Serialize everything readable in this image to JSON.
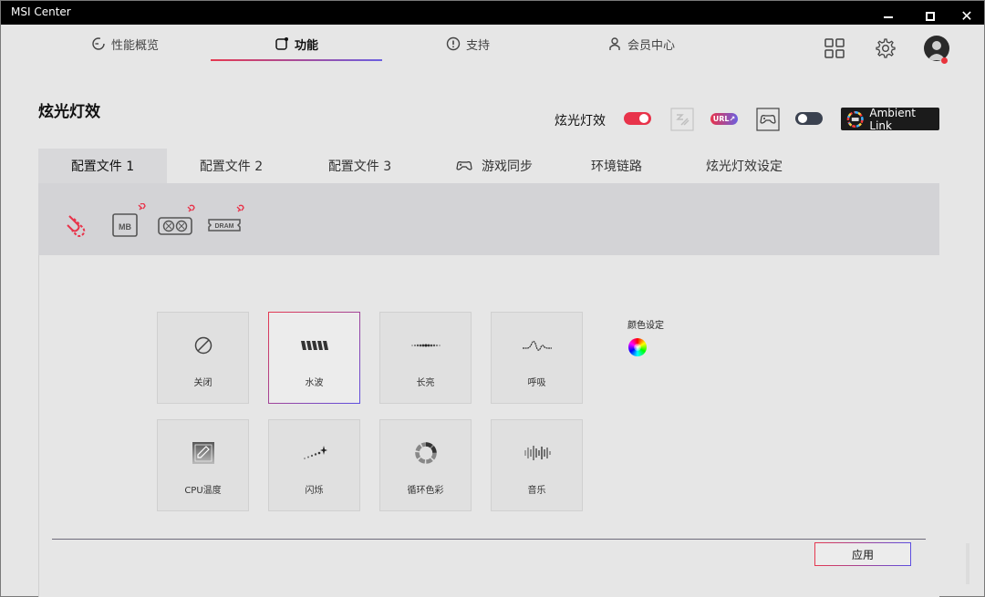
{
  "window": {
    "title": "MSI Center",
    "minimize": "",
    "maximize": "",
    "close": "✕"
  },
  "topnav": {
    "tabs": [
      {
        "label": "性能概览",
        "icon": "gauge-icon"
      },
      {
        "label": "功能",
        "icon": "features-icon",
        "active": true
      },
      {
        "label": "支持",
        "icon": "support-icon"
      },
      {
        "label": "会员中心",
        "icon": "user-icon"
      }
    ],
    "right_icons": [
      "grid-icon",
      "gear-icon",
      "avatar"
    ]
  },
  "section": {
    "title": "炫光灯效",
    "rgb_toggle_label": "炫光灯效",
    "rgb_toggle_on": true,
    "sync_toggle_on": false,
    "url_badge": "URL↗",
    "ambient_link": "Ambient Link"
  },
  "profile_tabs": [
    {
      "label": "配置文件 1",
      "active": true
    },
    {
      "label": "配置文件 2"
    },
    {
      "label": "配置文件 3"
    },
    {
      "label": "游戏同步",
      "icon": "gamepad-icon"
    },
    {
      "label": "环境链路"
    },
    {
      "label": "炫光灯效设定"
    }
  ],
  "devices": [
    {
      "name": "link-all",
      "label": ""
    },
    {
      "name": "motherboard",
      "label": "MB"
    },
    {
      "name": "graphics-card",
      "label": ""
    },
    {
      "name": "dram",
      "label": "DRAM"
    }
  ],
  "effects": [
    {
      "label": "关闭",
      "icon": "off-icon"
    },
    {
      "label": "水波",
      "icon": "wave-icon",
      "selected": true
    },
    {
      "label": "长亮",
      "icon": "steady-icon"
    },
    {
      "label": "呼吸",
      "icon": "breathing-icon"
    },
    {
      "label": "CPU温度",
      "icon": "cpu-temp-icon"
    },
    {
      "label": "闪烁",
      "icon": "flash-icon"
    },
    {
      "label": "循环色彩",
      "icon": "color-cycle-icon"
    },
    {
      "label": "音乐",
      "icon": "music-icon"
    }
  ],
  "color_settings": {
    "label": "颜色设定"
  },
  "apply_label": "应用",
  "colors": {
    "accent_red": "#e8334a",
    "accent_blue": "#5d4ee0",
    "bg": "#e6e6e6",
    "strip": "#d3d3d6"
  }
}
